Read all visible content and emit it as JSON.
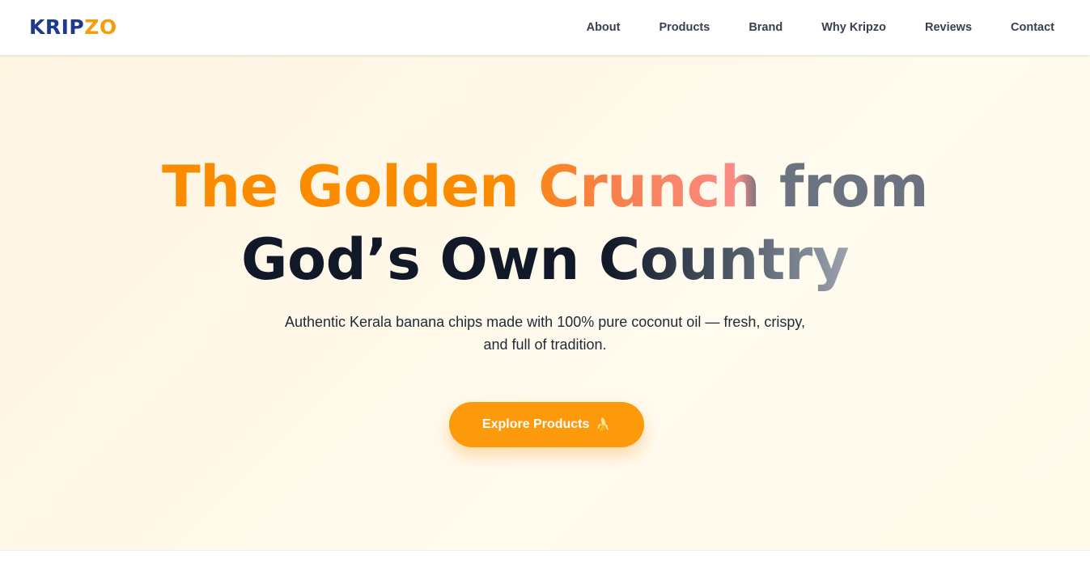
{
  "header": {
    "logo": {
      "part_a": "KRIP",
      "part_b": "ZO"
    },
    "nav": [
      "About",
      "Products",
      "Brand",
      "Why Kripzo",
      "Reviews",
      "Contact"
    ]
  },
  "hero": {
    "headline_line1": "The Golden Crunch from",
    "headline_line2": "God’s Own Country",
    "subtitle_line1": "Authentic Kerala banana chips made with 100% pure coconut oil — fresh, crispy,",
    "subtitle_line2": "and full of tradition.",
    "cta": {
      "label": "Explore Products",
      "icon": "🍌"
    }
  },
  "colors": {
    "brand_blue": "#1e3a8a",
    "brand_orange": "#fb8c00",
    "hero_background": "#fef8e6"
  }
}
